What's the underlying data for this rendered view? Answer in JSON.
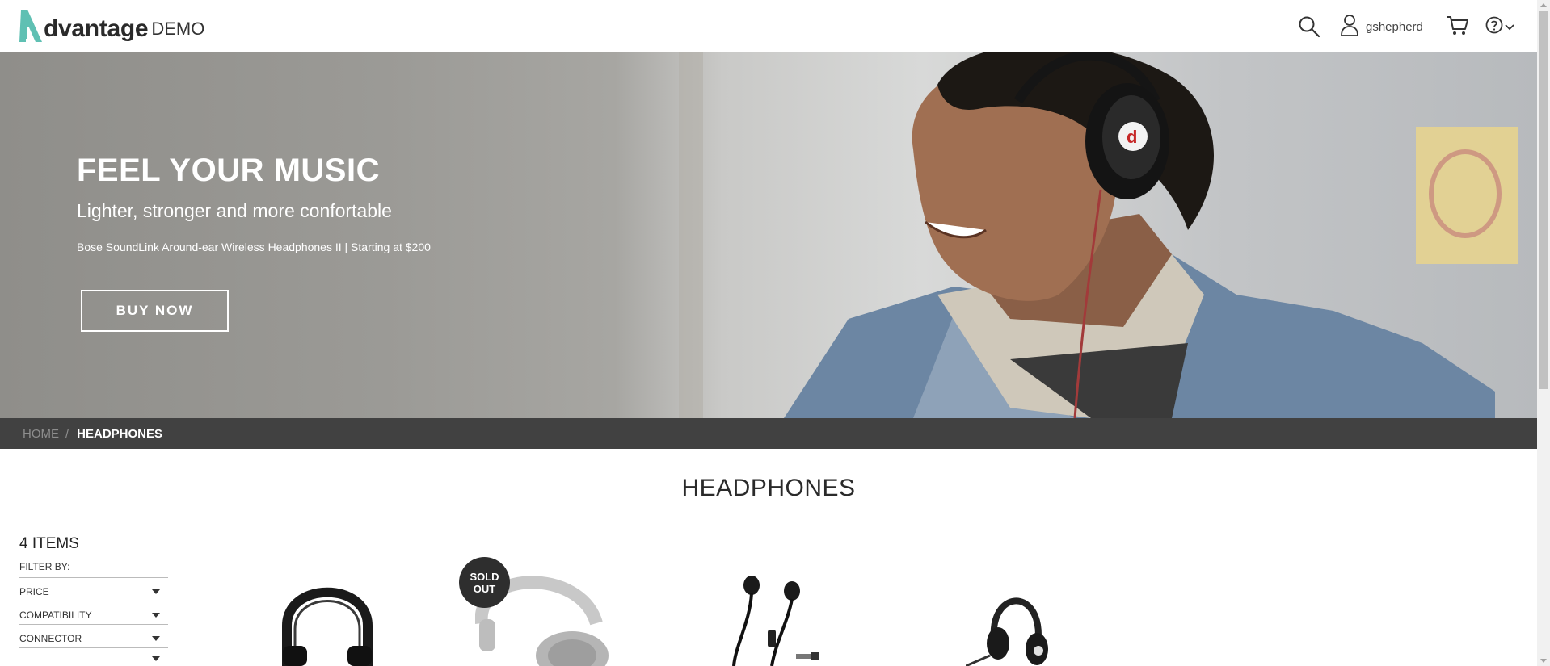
{
  "header": {
    "logo_text": "dvantage",
    "logo_suffix": "DEMO",
    "username": "gshepherd",
    "icons": [
      "search-icon",
      "user-icon",
      "cart-icon",
      "help-icon",
      "chevron-down-icon"
    ]
  },
  "hero": {
    "title": "FEEL YOUR MUSIC",
    "subtitle": "Lighter, stronger and more confortable",
    "description": "Bose SoundLink Around-ear Wireless Headphones II | Starting at $200",
    "button_label": "BUY NOW"
  },
  "breadcrumb": {
    "home": "HOME",
    "separator": "/",
    "current": "HEADPHONES"
  },
  "page": {
    "title": "HEADPHONES"
  },
  "sidebar": {
    "items_count": "4 ITEMS",
    "filter_by": "FILTER BY:",
    "filters": [
      {
        "label": "PRICE"
      },
      {
        "label": "COMPATIBILITY"
      },
      {
        "label": "CONNECTOR"
      }
    ]
  },
  "products": {
    "sold_out_line1": "SOLD",
    "sold_out_line2": "OUT"
  },
  "colors": {
    "brand_teal": "#4db6ac",
    "breadcrumb_bg": "#414141",
    "badge_bg": "#2e2e2e"
  }
}
